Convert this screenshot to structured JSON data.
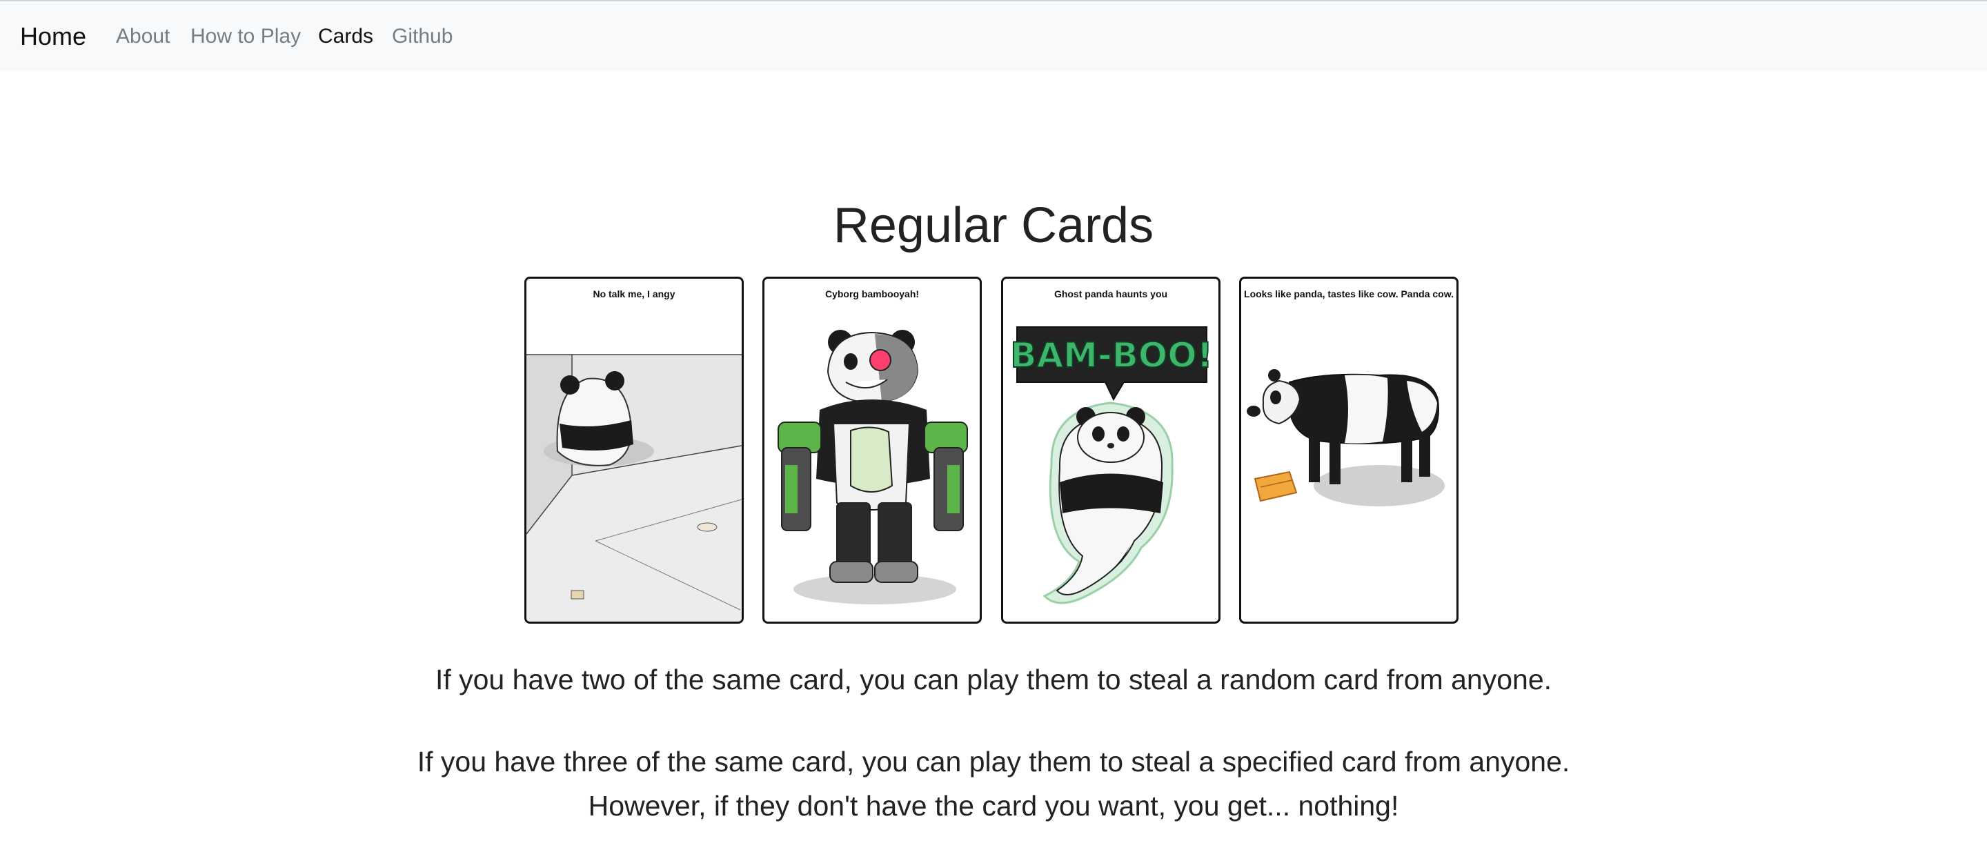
{
  "nav": {
    "brand": "Home",
    "items": [
      {
        "label": "About"
      },
      {
        "label": "How to Play"
      },
      {
        "label": "Cards"
      },
      {
        "label": "Github"
      }
    ]
  },
  "section": {
    "title": "Regular Cards"
  },
  "cards": [
    {
      "caption": "No talk me, I angy",
      "art": "angry-panda-in-corner"
    },
    {
      "caption": "Cyborg bambooyah!",
      "art": "cyborg-panda"
    },
    {
      "caption": "Ghost panda haunts you",
      "art": "ghost-panda",
      "speech": "BAM-BOO!"
    },
    {
      "caption": "Looks like panda, tastes like cow.  Panda cow.",
      "art": "panda-cow"
    }
  ],
  "rules": {
    "pair": "If you have two of the same card, you can play them to steal a random card from anyone.",
    "triple_line1": "If you have three of the same card, you can play them to steal a specified card from anyone.",
    "triple_line2": "However, if they don't have the card you want, you get... nothing!"
  }
}
